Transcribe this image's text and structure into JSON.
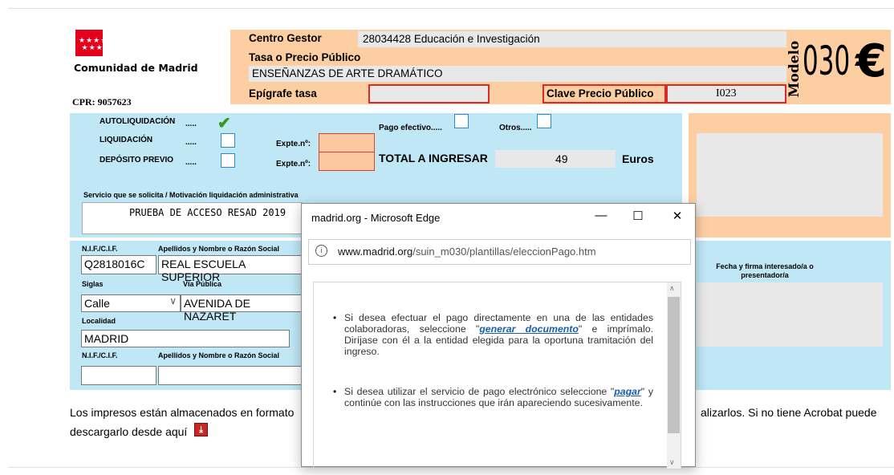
{
  "header": {
    "logo_text": "Comunidad de Madrid",
    "cpr": "CPR: 9057623",
    "centro_gestor_label": "Centro Gestor",
    "centro_gestor_value": "28034428 Educación e Investigación",
    "tasa_label": "Tasa o Precio Público",
    "tasa_value": "ENSEÑANZAS DE ARTE DRAMÁTICO",
    "epigrafe_label": "Epígrafe tasa",
    "epigrafe_value": "",
    "clave_label": "Clave Precio Público",
    "clave_value": "I023",
    "modelo_label": "Modelo",
    "modelo_number": "030",
    "euro_symbol": "€"
  },
  "options": {
    "autoliquidacion": "AUTOLIQUIDACIÓN",
    "liquidacion": "LIQUIDACIÓN",
    "deposito": "DEPÓSITO PREVIO",
    "dots": ".....",
    "expte_label": "Expte.nº:",
    "pago_efectivo": "Pago efectivo.....",
    "otros": "Otros.....",
    "total_label": "TOTAL A INGRESAR",
    "total_value": "49",
    "euros": "Euros"
  },
  "servicio": {
    "label": "Servicio que se solicita / Motivación liquidación administrativa",
    "value": "PRUEBA DE ACCESO RESAD 2019"
  },
  "persona": {
    "nif_label": "N.I.F./C.I.F.",
    "nombre_label": "Apellidos y Nombre o Razón Social",
    "nif_value": "Q2818016C",
    "nombre_value": "REAL ESCUELA SUPERIOR",
    "siglas_label": "Siglas",
    "via_label": "Vía Pública",
    "siglas_value": "Calle",
    "via_value": "AVENIDA DE NAZARET",
    "localidad_label": "Localidad",
    "localidad_value": "MADRID",
    "nif2_label": "N.I.F./C.I.F.",
    "nombre2_label": "Apellidos y Nombre o Razón Social",
    "firma_label": "Fecha y firma interesado/a o presentador/a"
  },
  "footer": {
    "text_left": "Los impresos están almacenados en formato",
    "text_right": "alizarlos. Si no tiene Acrobat puede",
    "text_line2": "descargarlo desde aquí"
  },
  "dialog": {
    "title": "madrid.org - Microsoft Edge",
    "url_domain": "www.madrid.org",
    "url_path": "/suin_m030/plantillas/eleccionPago.htm",
    "p1_a": "Si desea efectuar el pago directamente en una de las entidades colaboradoras, seleccione \"",
    "p1_link": "generar documento",
    "p1_b": "\" e imprímalo. Diríjase con él a la entidad elegida para la oportuna tramitación del ingreso.",
    "p2_a": "Si desea utilizar el servicio de pago electrónico seleccione \"",
    "p2_link": "pagar",
    "p2_b": "\" y continúe con las instrucciones que irán apareciendo sucesivamente."
  }
}
